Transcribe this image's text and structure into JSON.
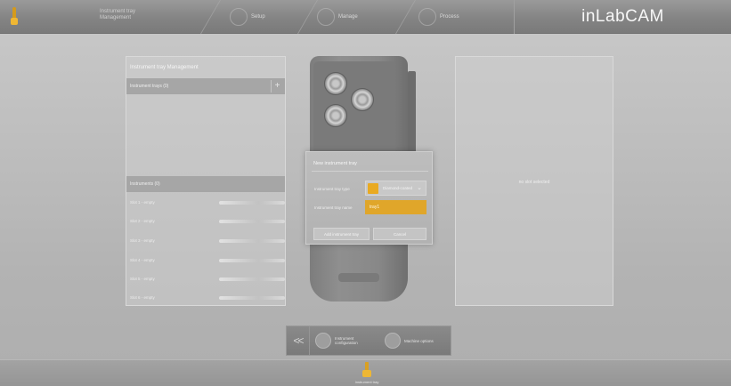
{
  "header": {
    "crumb_line1": "Instrument tray",
    "crumb_line2": "Management",
    "steps": [
      {
        "label": "Setup"
      },
      {
        "label": "Manage"
      },
      {
        "label": "Process"
      }
    ],
    "brand": "inLabCAM"
  },
  "left_panel": {
    "title": "Instrument tray Management",
    "trays_header": "Instrument trays (0)",
    "add_symbol": "+",
    "instruments_header": "Instruments (0)",
    "slots": [
      {
        "label": "Slot 1 - empty"
      },
      {
        "label": "Slot 2 - empty"
      },
      {
        "label": "Slot 3 - empty"
      },
      {
        "label": "Slot 4 - empty"
      },
      {
        "label": "Slot 5 - empty"
      },
      {
        "label": "Slot 6 - empty"
      }
    ]
  },
  "right_panel": {
    "empty_text": "no slot selected"
  },
  "dialog": {
    "title": "New instrument tray",
    "type_label": "Instrument tray type",
    "type_value": "Diamond-coated",
    "name_label": "Instrument tray name",
    "name_value": "tray1",
    "add_button": "Add instrument tray",
    "cancel_button": "Cancel",
    "accent_color": "#e0a62a"
  },
  "bottom_toolbar": {
    "back_symbol": "<<",
    "item1": "Instrument configuration",
    "item2": "Machine options"
  },
  "footer": {
    "label": "Instrument tray"
  }
}
